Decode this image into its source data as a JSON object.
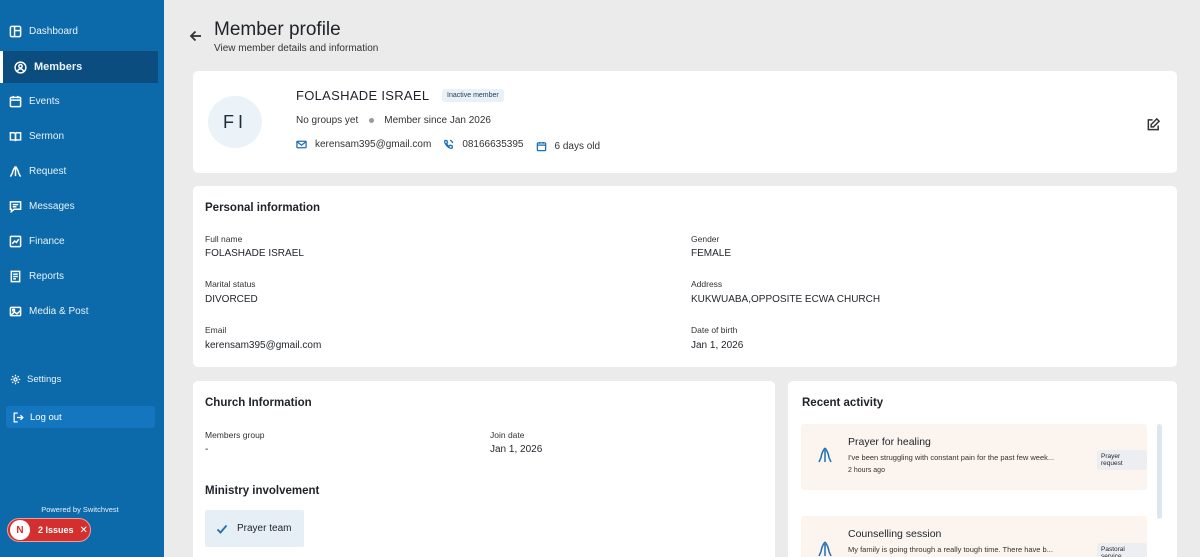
{
  "sidebar": {
    "items": [
      {
        "label": "Dashboard",
        "icon": "dashboard-icon"
      },
      {
        "label": "Members",
        "icon": "members-icon"
      },
      {
        "label": "Events",
        "icon": "calendar-icon"
      },
      {
        "label": "Sermon",
        "icon": "book-icon"
      },
      {
        "label": "Request",
        "icon": "praying-hands-icon"
      },
      {
        "label": "Messages",
        "icon": "message-icon"
      },
      {
        "label": "Finance",
        "icon": "chart-icon"
      },
      {
        "label": "Reports",
        "icon": "report-icon"
      },
      {
        "label": "Media & Post",
        "icon": "media-icon"
      }
    ],
    "settings": "Settings",
    "logout": "Log out",
    "powered_by": "Powered by Switchvest",
    "issues_badge": "N",
    "issues": "2 Issues",
    "issues_close": "✕"
  },
  "header": {
    "title": "Member profile",
    "subtitle": "View member details and information"
  },
  "profile": {
    "initials": "FI",
    "name": "FOLASHADE ISRAEL",
    "status_badge": "Inactive member",
    "groups": "No groups yet",
    "member_since": "Member since Jan 2026",
    "email": "kerensam395@gmail.com",
    "phone": "08166635395",
    "age": "6 days old"
  },
  "personal": {
    "title": "Personal information",
    "full_name_label": "Full name",
    "full_name": "FOLASHADE ISRAEL",
    "gender_label": "Gender",
    "gender": "FEMALE",
    "marital_label": "Marital status",
    "marital": "DIVORCED",
    "address_label": "Address",
    "address": "KUKWUABA,OPPOSITE ECWA CHURCH",
    "email_label": "Email",
    "email": "kerensam395@gmail.com",
    "dob_label": "Date of birth",
    "dob": "Jan 1, 2026"
  },
  "church": {
    "title": "Church Information",
    "group_label": "Members group",
    "group": "-",
    "join_label": "Join date",
    "join": "Jan 1, 2026",
    "ministry_title": "Ministry involvement",
    "ministry": "Prayer team"
  },
  "activity": {
    "title": "Recent activity",
    "items": [
      {
        "title": "Prayer for healing",
        "desc": "I've been struggling with constant pain for the past few week...",
        "time": "2 hours ago",
        "tag": "Prayer request"
      },
      {
        "title": "Counselling session",
        "desc": "My family is going through a really tough time. There have b...",
        "time": "",
        "tag": "Pastoral service"
      }
    ]
  },
  "colors": {
    "sidebar": "#0d6aaa",
    "sidebar_active": "#0c4d80",
    "accent": "#1f6fb2",
    "issues": "#d32f2f"
  }
}
